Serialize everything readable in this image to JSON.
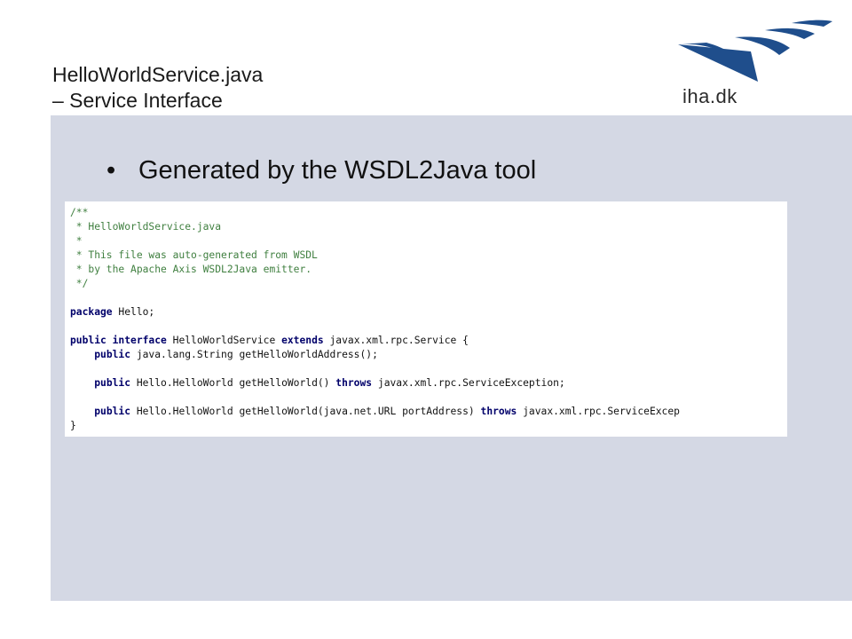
{
  "title": {
    "line1": "HelloWorldService.java",
    "line2": "– Service Interface"
  },
  "logo": {
    "text": "iha.dk",
    "color": "#1f4e8c"
  },
  "bullet": {
    "text": "Generated by the WSDL2Java tool"
  },
  "code": {
    "comment_lines": [
      "/**",
      " * HelloWorldService.java",
      " *",
      " * This file was auto-generated from WSDL",
      " * by the Apache Axis WSDL2Java emitter.",
      " */"
    ],
    "package_kw": "package",
    "package_rest": " Hello;",
    "iface_kw1": "public",
    "iface_kw2": "interface",
    "iface_name": " HelloWorldService ",
    "iface_kw3": "extends",
    "iface_rest": " javax.xml.rpc.Service {",
    "m1_kw": "public",
    "m1_rest": " java.lang.String getHelloWorldAddress();",
    "m2_kw": "public",
    "m2_mid": " Hello.HelloWorld getHelloWorld() ",
    "m2_throws": "throws",
    "m2_rest": " javax.xml.rpc.ServiceException;",
    "m3_kw": "public",
    "m3_mid": " Hello.HelloWorld getHelloWorld(java.net.URL portAddress) ",
    "m3_throws": "throws",
    "m3_rest": " javax.xml.rpc.ServiceExcep",
    "close": "}"
  }
}
